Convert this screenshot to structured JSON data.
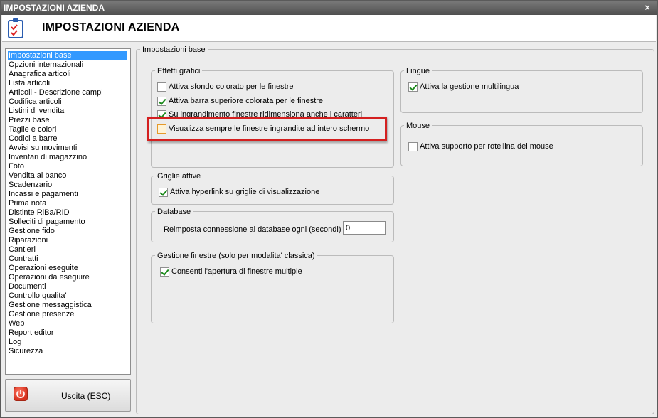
{
  "window": {
    "title": "IMPOSTAZIONI AZIENDA",
    "close_glyph": "×"
  },
  "header": {
    "title": "IMPOSTAZIONI AZIENDA",
    "icon": "checklist-icon"
  },
  "nav": {
    "items": [
      "Impostazioni base",
      "Opzioni internazionali",
      "Anagrafica articoli",
      "Lista articoli",
      "Articoli - Descrizione campi",
      "Codifica articoli",
      "Listini di vendita",
      "Prezzi base",
      "Taglie e colori",
      "Codici a barre",
      "Avvisi su movimenti",
      "Inventari di magazzino",
      "Foto",
      "Vendita al banco",
      "Scadenzario",
      "Incassi e pagamenti",
      "Prima nota",
      "Distinte RiBa/RID",
      "Solleciti di pagamento",
      "Gestione fido",
      "Riparazioni",
      "Cantieri",
      "Contratti",
      "Operazioni eseguite",
      "Operazioni da eseguire",
      "Documenti",
      "Controllo qualita'",
      "Gestione messaggistica",
      "Gestione presenze",
      "Web",
      "Report editor",
      "Log",
      "Sicurezza"
    ],
    "selected": "Impostazioni base"
  },
  "exit_button": {
    "label": "Uscita (ESC)",
    "icon": "power-icon"
  },
  "main": {
    "caption": "Impostazioni base",
    "effetti": {
      "caption": "Effetti grafici",
      "options": [
        {
          "label": "Attiva sfondo colorato per le finestre",
          "checked": false
        },
        {
          "label": "Attiva barra superiore colorata per le finestre",
          "checked": true
        },
        {
          "label": "Su ingrandimento finestre ridimensiona anche i caratteri",
          "checked": true
        },
        {
          "label": "Visualizza sempre le finestre ingrandite ad intero schermo",
          "checked": false
        }
      ]
    },
    "griglie": {
      "caption": "Griglie attive",
      "option": {
        "label": "Attiva hyperlink su griglie di visualizzazione",
        "checked": true
      }
    },
    "database": {
      "caption": "Database",
      "label": "Reimposta connessione al database ogni (secondi) :",
      "value": "0"
    },
    "gestione": {
      "caption": "Gestione finestre (solo per modalita' classica)",
      "option": {
        "label": "Consenti l'apertura di finestre multiple",
        "checked": true
      }
    },
    "lingue": {
      "caption": "Lingue",
      "option": {
        "label": "Attiva la gestione multilingua",
        "checked": true
      }
    },
    "mouse": {
      "caption": "Mouse",
      "option": {
        "label": "Attiva supporto per rotellina del mouse",
        "checked": false
      }
    }
  },
  "colors": {
    "selection": "#3399ff",
    "highlight": "#d42020",
    "check": "#1c8a1c"
  }
}
